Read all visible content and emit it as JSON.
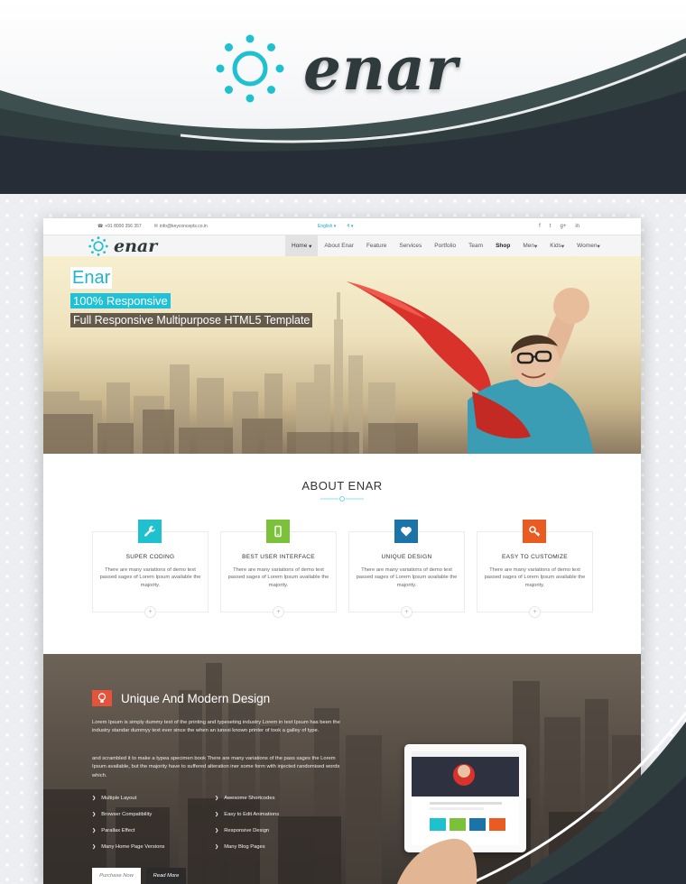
{
  "banner": {
    "brand": "enar"
  },
  "topbar": {
    "phone": "+91 8000 356 357",
    "email": "info@keyconcepts.co.in",
    "language": "English",
    "currency": "₹",
    "social": [
      "f",
      "t",
      "g+",
      "in"
    ]
  },
  "nav": {
    "logo": "enar",
    "items": [
      "Home",
      "About Enar",
      "Feature",
      "Services",
      "Portfolio",
      "Team",
      "Shop",
      "Men",
      "Kids",
      "Women"
    ]
  },
  "hero": {
    "title": "Enar",
    "subtitle1": "100% Responsive",
    "subtitle2": "Full Responsive Multipurpose HTML5 Template"
  },
  "about": {
    "heading": "ABOUT ENAR",
    "cards": [
      {
        "title": "SUPER CODING",
        "icon": "wrench-icon",
        "color": "#1fc1cf",
        "text": "There are many variations of demo text passed sages of Lorem Ipsum available the majority."
      },
      {
        "title": "BEST USER INTERFACE",
        "icon": "mobile-icon",
        "color": "#7cc13a",
        "text": "There are many variations of demo text passed sages of Lorem Ipsum available the majority."
      },
      {
        "title": "UNIQUE DESIGN",
        "icon": "heart-icon",
        "color": "#1a74a8",
        "text": "There are many variations of demo text passed sages of Lorem Ipsum available the majority."
      },
      {
        "title": "EASY TO CUSTOMIZE",
        "icon": "key-icon",
        "color": "#ea5b22",
        "text": "There are many variations of demo text passed sages of Lorem Ipsum available the majority."
      }
    ]
  },
  "design": {
    "heading": "Unique And Modern Design",
    "para1": "Lorem Ipsum is simply dummy text of the printing and typeseting industry Lorem in text Ipsum has been the industry standar dummyy text ever since the when an iunesi known printer of took a galley of type.",
    "para2": "and scrambled it to make a typea specimen book There are many variations of the pass sages the Lorem Ipsum available, but the majority have to suffered alteration iner some form with injected randomised words which.",
    "features_left": [
      "Multiple Layout",
      "Browser Compatibility",
      "Parallax Effect",
      "Many Home Page Versions"
    ],
    "features_right": [
      "Awesome Shortcodes",
      "Easy to Edit Animations",
      "Responsive Design",
      "Many Blog Pages"
    ],
    "purchase_label": "Purchase Now",
    "read_label": "Read More"
  }
}
